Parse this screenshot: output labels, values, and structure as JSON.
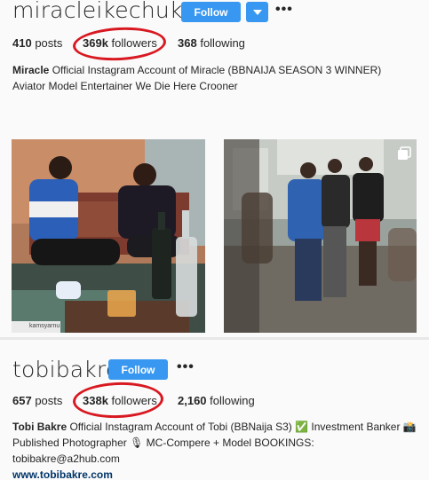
{
  "profile_top": {
    "username": "miracleikechukwu",
    "follow_label": "Follow",
    "more_label": "•••",
    "posts_count": "410",
    "posts_label": "posts",
    "followers_count": "369k",
    "followers_label": "followers",
    "following_count": "368",
    "following_label": "following",
    "bio_name": "Miracle",
    "bio_text": " Official Instagram Account of Miracle (BBNAIJA SEASON 3 WINNER) Aviator Model Entertainer We Die Here Crooner",
    "photo_caption": "kamsyarnu"
  },
  "profile_bottom": {
    "username": "tobibakre",
    "follow_label": "Follow",
    "more_label": "•••",
    "posts_count": "657",
    "posts_label": "posts",
    "followers_count": "338k",
    "followers_label": "followers",
    "following_count": "2,160",
    "following_label": "following",
    "bio_name": "Tobi Bakre",
    "bio_text": " Official Instagram Account of Tobi (BBNaija S3) ✅ Investment Banker 📸 Published Photographer 🎙 MC-Compere + Model BOOKINGS: tobibakre@a2hub.com",
    "website": "www.tobibakre.com"
  },
  "colors": {
    "follow_button": "#3897f0",
    "annotation_ring": "#d81921",
    "link": "#003569"
  }
}
